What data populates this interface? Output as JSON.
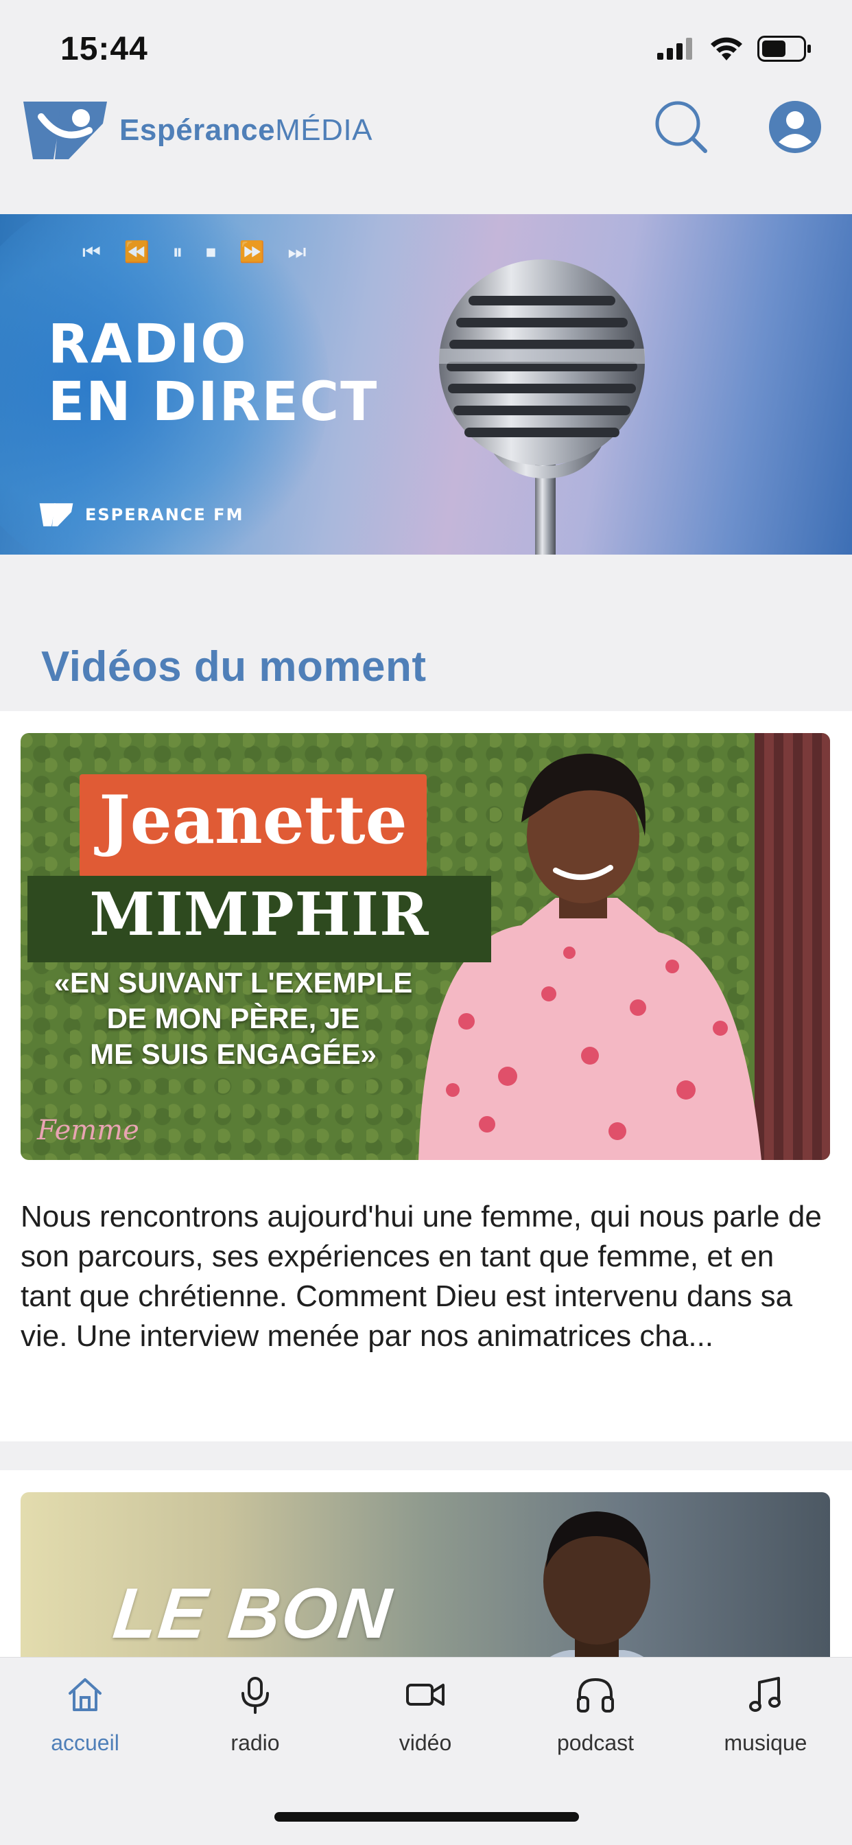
{
  "status_bar": {
    "time": "15:44",
    "icons": [
      "signal-icon",
      "wifi-icon",
      "battery-icon"
    ]
  },
  "header": {
    "logo_text_bold": "Espérance",
    "logo_text_light": "MÉDIA",
    "actions": [
      "search-icon",
      "account-icon"
    ]
  },
  "live_banner": {
    "controls": "⏮ ⏪  ⏸ ⏹  ⏩ ⏭",
    "title_line1": "RADIO",
    "title_line2": "EN DIRECT",
    "brand": "ESPERANCE FM"
  },
  "section": {
    "title": "Vidéos du moment"
  },
  "featured_video": {
    "first_name": "Jeanette",
    "last_name": "MIMPHIR",
    "quote_line1": "«EN SUIVANT L'EXEMPLE",
    "quote_line2": "DE MON PÈRE, JE",
    "quote_line3": "ME SUIS ENGAGÉE»",
    "series_logo": "Femme",
    "description": "Nous rencontrons aujourd'hui une femme, qui nous parle de son parcours, ses expériences en tant que femme, et en tant que chrétienne. Comment Dieu est intervenu dans sa vie. Une interview menée par nos animatrices cha..."
  },
  "next_video": {
    "title": "LE BON"
  },
  "tab_bar": {
    "tabs": [
      {
        "label": "accueil",
        "icon": "home-icon",
        "active": true
      },
      {
        "label": "radio",
        "icon": "microphone-icon",
        "active": false
      },
      {
        "label": "vidéo",
        "icon": "video-camera-icon",
        "active": false
      },
      {
        "label": "podcast",
        "icon": "headphones-icon",
        "active": false
      },
      {
        "label": "musique",
        "icon": "music-note-icon",
        "active": false
      }
    ]
  },
  "colors": {
    "accent": "#4f7fb8",
    "background": "#f0f0f2",
    "name_tag": "#e05b35",
    "name_tag_dark": "#2e4a1f"
  }
}
